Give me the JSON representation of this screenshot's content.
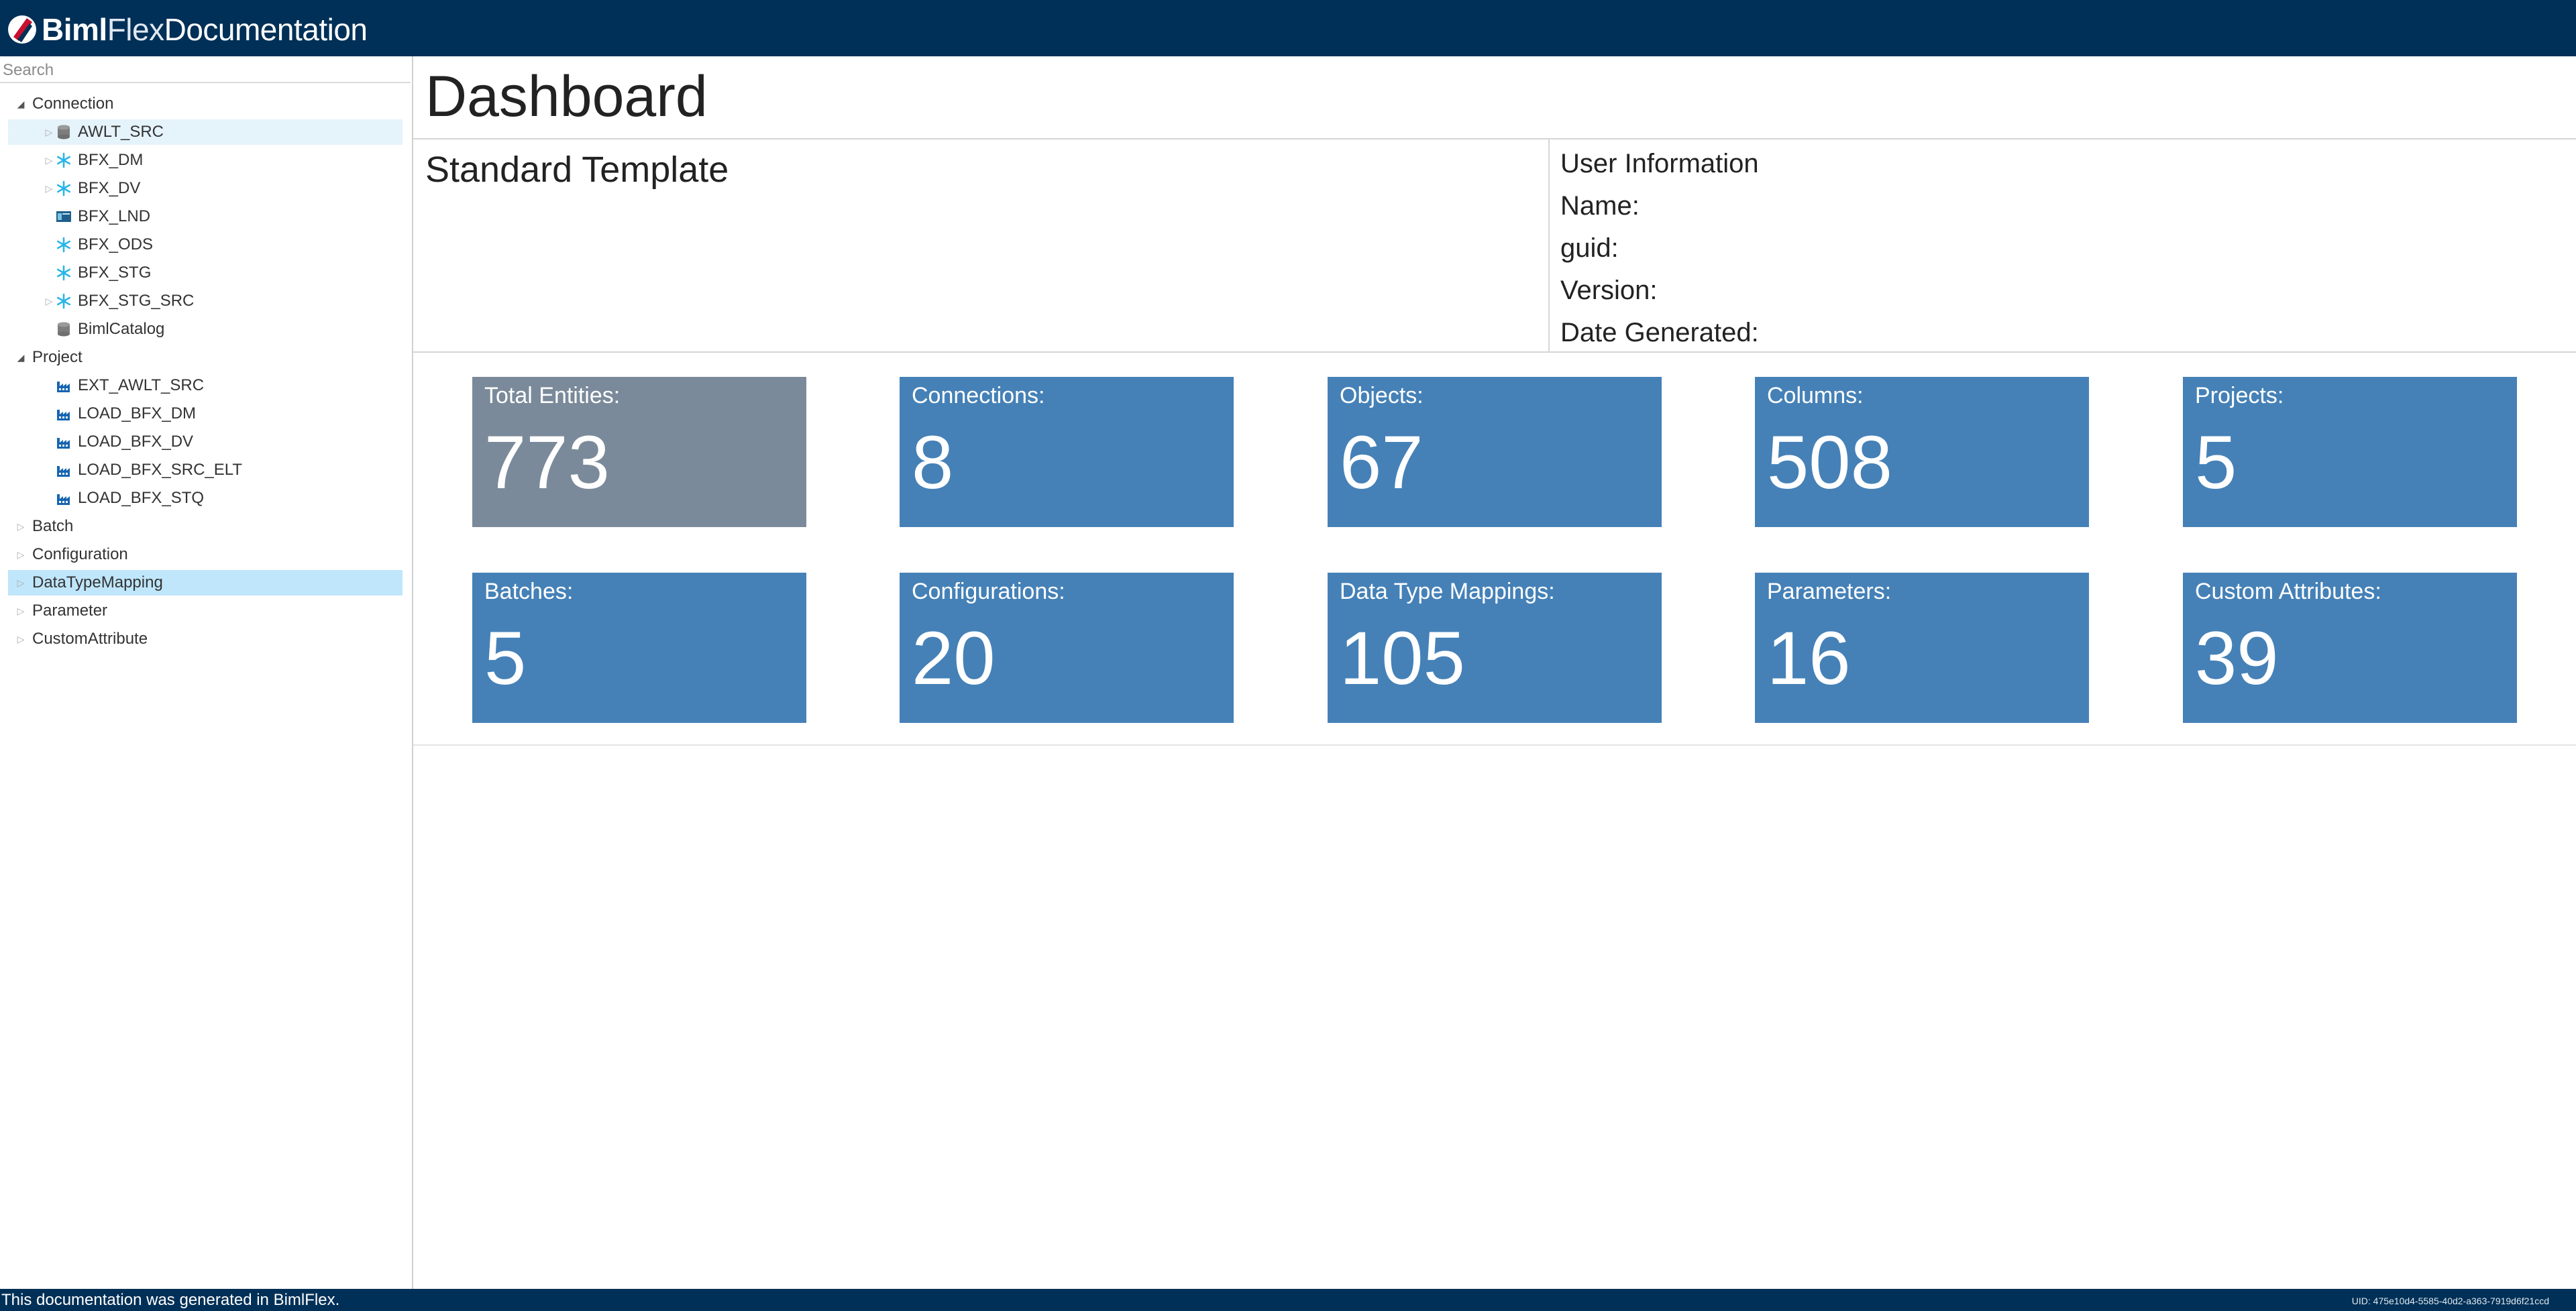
{
  "app": {
    "logo_bold": "Biml",
    "logo_thin": "Flex",
    "logo_rest": "Documentation"
  },
  "colors": {
    "header_bg": "#003057",
    "tile_blue": "#4581b7",
    "tile_grey": "#7a8a9a",
    "selected": "#bfe6fb"
  },
  "sidebar": {
    "search_placeholder": "Search",
    "tree": [
      {
        "label": "Connection",
        "level": 0,
        "arrow": "expanded"
      },
      {
        "label": "AWLT_SRC",
        "level": 1,
        "arrow": "collapsed",
        "icon": "database-icon",
        "state": "hover"
      },
      {
        "label": "BFX_DM",
        "level": 1,
        "arrow": "collapsed",
        "icon": "snowflake-icon"
      },
      {
        "label": "BFX_DV",
        "level": 1,
        "arrow": "collapsed",
        "icon": "snowflake-icon"
      },
      {
        "label": "BFX_LND",
        "level": 1,
        "arrow": "none",
        "icon": "storage-icon"
      },
      {
        "label": "BFX_ODS",
        "level": 1,
        "arrow": "none",
        "icon": "snowflake-icon"
      },
      {
        "label": "BFX_STG",
        "level": 1,
        "arrow": "none",
        "icon": "snowflake-icon"
      },
      {
        "label": "BFX_STG_SRC",
        "level": 1,
        "arrow": "collapsed",
        "icon": "snowflake-icon"
      },
      {
        "label": "BimlCatalog",
        "level": 1,
        "arrow": "none",
        "icon": "database-icon"
      },
      {
        "label": "Project",
        "level": 0,
        "arrow": "expanded"
      },
      {
        "label": "EXT_AWLT_SRC",
        "level": 1,
        "arrow": "none",
        "icon": "factory-icon"
      },
      {
        "label": "LOAD_BFX_DM",
        "level": 1,
        "arrow": "none",
        "icon": "factory-icon"
      },
      {
        "label": "LOAD_BFX_DV",
        "level": 1,
        "arrow": "none",
        "icon": "factory-icon"
      },
      {
        "label": "LOAD_BFX_SRC_ELT",
        "level": 1,
        "arrow": "none",
        "icon": "factory-icon"
      },
      {
        "label": "LOAD_BFX_STQ",
        "level": 1,
        "arrow": "none",
        "icon": "factory-icon"
      },
      {
        "label": "Batch",
        "level": 0,
        "arrow": "collapsed"
      },
      {
        "label": "Configuration",
        "level": 0,
        "arrow": "collapsed"
      },
      {
        "label": "DataTypeMapping",
        "level": 0,
        "arrow": "collapsed",
        "state": "selected"
      },
      {
        "label": "Parameter",
        "level": 0,
        "arrow": "collapsed"
      },
      {
        "label": "CustomAttribute",
        "level": 0,
        "arrow": "collapsed"
      }
    ]
  },
  "main": {
    "title": "Dashboard",
    "template_name": "Standard Template",
    "user_info": {
      "heading": "User Information",
      "name_label": "Name:",
      "guid_label": "guid:",
      "version_label": "Version:",
      "date_label": "Date Generated:"
    },
    "tiles": [
      {
        "label": "Total Entities:",
        "value": "773",
        "color": "grey"
      },
      {
        "label": "Connections:",
        "value": "8",
        "color": "blue"
      },
      {
        "label": "Objects:",
        "value": "67",
        "color": "blue"
      },
      {
        "label": "Columns:",
        "value": "508",
        "color": "blue"
      },
      {
        "label": "Projects:",
        "value": "5",
        "color": "blue"
      },
      {
        "label": "Batches:",
        "value": "5",
        "color": "blue"
      },
      {
        "label": "Configurations:",
        "value": "20",
        "color": "blue"
      },
      {
        "label": "Data Type Mappings:",
        "value": "105",
        "color": "blue"
      },
      {
        "label": "Parameters:",
        "value": "16",
        "color": "blue"
      },
      {
        "label": "Custom Attributes:",
        "value": "39",
        "color": "blue"
      }
    ]
  },
  "footer": {
    "text": "This documentation was generated in BimlFlex.",
    "uid": "UID: 475e10d4-5585-40d2-a363-7919d6f21ccd"
  }
}
